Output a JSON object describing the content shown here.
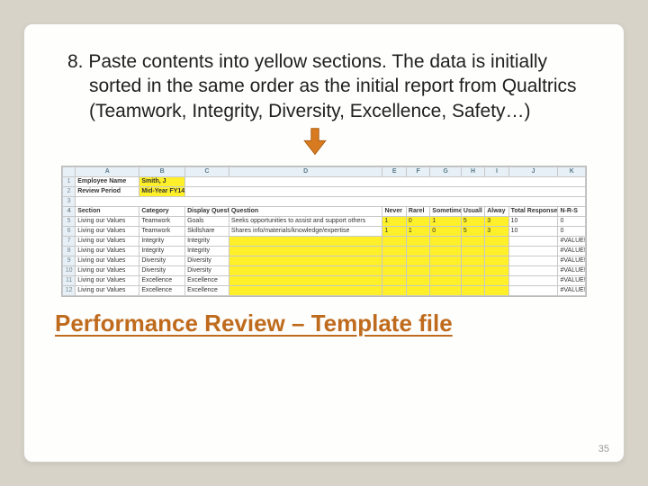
{
  "instruction_num": "8.",
  "instruction": " Paste contents into yellow sections.  The data is initially sorted in the same order as the initial report from Qualtrics (Teamwork, Integrity, Diversity, Excellence, Safety…)",
  "subtitle": "Performance Review – Template file",
  "page_number": "35",
  "sheet": {
    "colheads": [
      "",
      "A",
      "B",
      "C",
      "D",
      "E",
      "F",
      "G",
      "H",
      "I",
      "J",
      "K"
    ],
    "header1_label": "Employee Name",
    "header1_value": "Smith, J",
    "header2_label": "Review Period",
    "header2_value": "Mid-Year FY14",
    "cols": {
      "section": "Section",
      "category": "Category",
      "display": "Display Quest",
      "question": "Question",
      "never": "Never",
      "rarely": "Rarel",
      "sometimes": "Sometime",
      "usually": "Usuall",
      "always": "Alway",
      "total": "Total Responses",
      "nrs": "N-R-S"
    },
    "rows": [
      {
        "n": "1",
        "section": "Living our Values",
        "category": "Teamwork",
        "display": "Goals",
        "question": "Seeks opportunities to assist and support others",
        "c1": "1",
        "c2": "0",
        "c3": "1",
        "c4": "5",
        "c5": "3",
        "total": "10",
        "nrs": "0"
      },
      {
        "n": "2",
        "section": "Living our Values",
        "category": "Teamwork",
        "display": "Skillshare",
        "question": "Shares info/materials/knowledge/expertise",
        "c1": "1",
        "c2": "1",
        "c3": "0",
        "c4": "5",
        "c5": "3",
        "total": "10",
        "nrs": "0"
      },
      {
        "n": "3",
        "section": "Living our Values",
        "category": "Integrity",
        "display": "Integrity",
        "question": "",
        "c1": "",
        "c2": "",
        "c3": "",
        "c4": "",
        "c5": "",
        "total": "",
        "nrs": "#VALUE!"
      },
      {
        "n": "4",
        "section": "Living our Values",
        "category": "Integrity",
        "display": "Integrity",
        "question": "",
        "c1": "",
        "c2": "",
        "c3": "",
        "c4": "",
        "c5": "",
        "total": "",
        "nrs": "#VALUE!"
      },
      {
        "n": "5",
        "section": "Living our Values",
        "category": "Diversity",
        "display": "Diversity",
        "question": "",
        "c1": "",
        "c2": "",
        "c3": "",
        "c4": "",
        "c5": "",
        "total": "",
        "nrs": "#VALUE!"
      },
      {
        "n": "6",
        "section": "Living our Values",
        "category": "Diversity",
        "display": "Diversity",
        "question": "",
        "c1": "",
        "c2": "",
        "c3": "",
        "c4": "",
        "c5": "",
        "total": "",
        "nrs": "#VALUE!"
      },
      {
        "n": "7",
        "section": "Living our Values",
        "category": "Excellence",
        "display": "Excellence",
        "question": "",
        "c1": "",
        "c2": "",
        "c3": "",
        "c4": "",
        "c5": "",
        "total": "",
        "nrs": "#VALUE!"
      },
      {
        "n": "8",
        "section": "Living our Values",
        "category": "Excellence",
        "display": "Excellence",
        "question": "",
        "c1": "",
        "c2": "",
        "c3": "",
        "c4": "",
        "c5": "",
        "total": "",
        "nrs": "#VALUE!"
      }
    ]
  }
}
